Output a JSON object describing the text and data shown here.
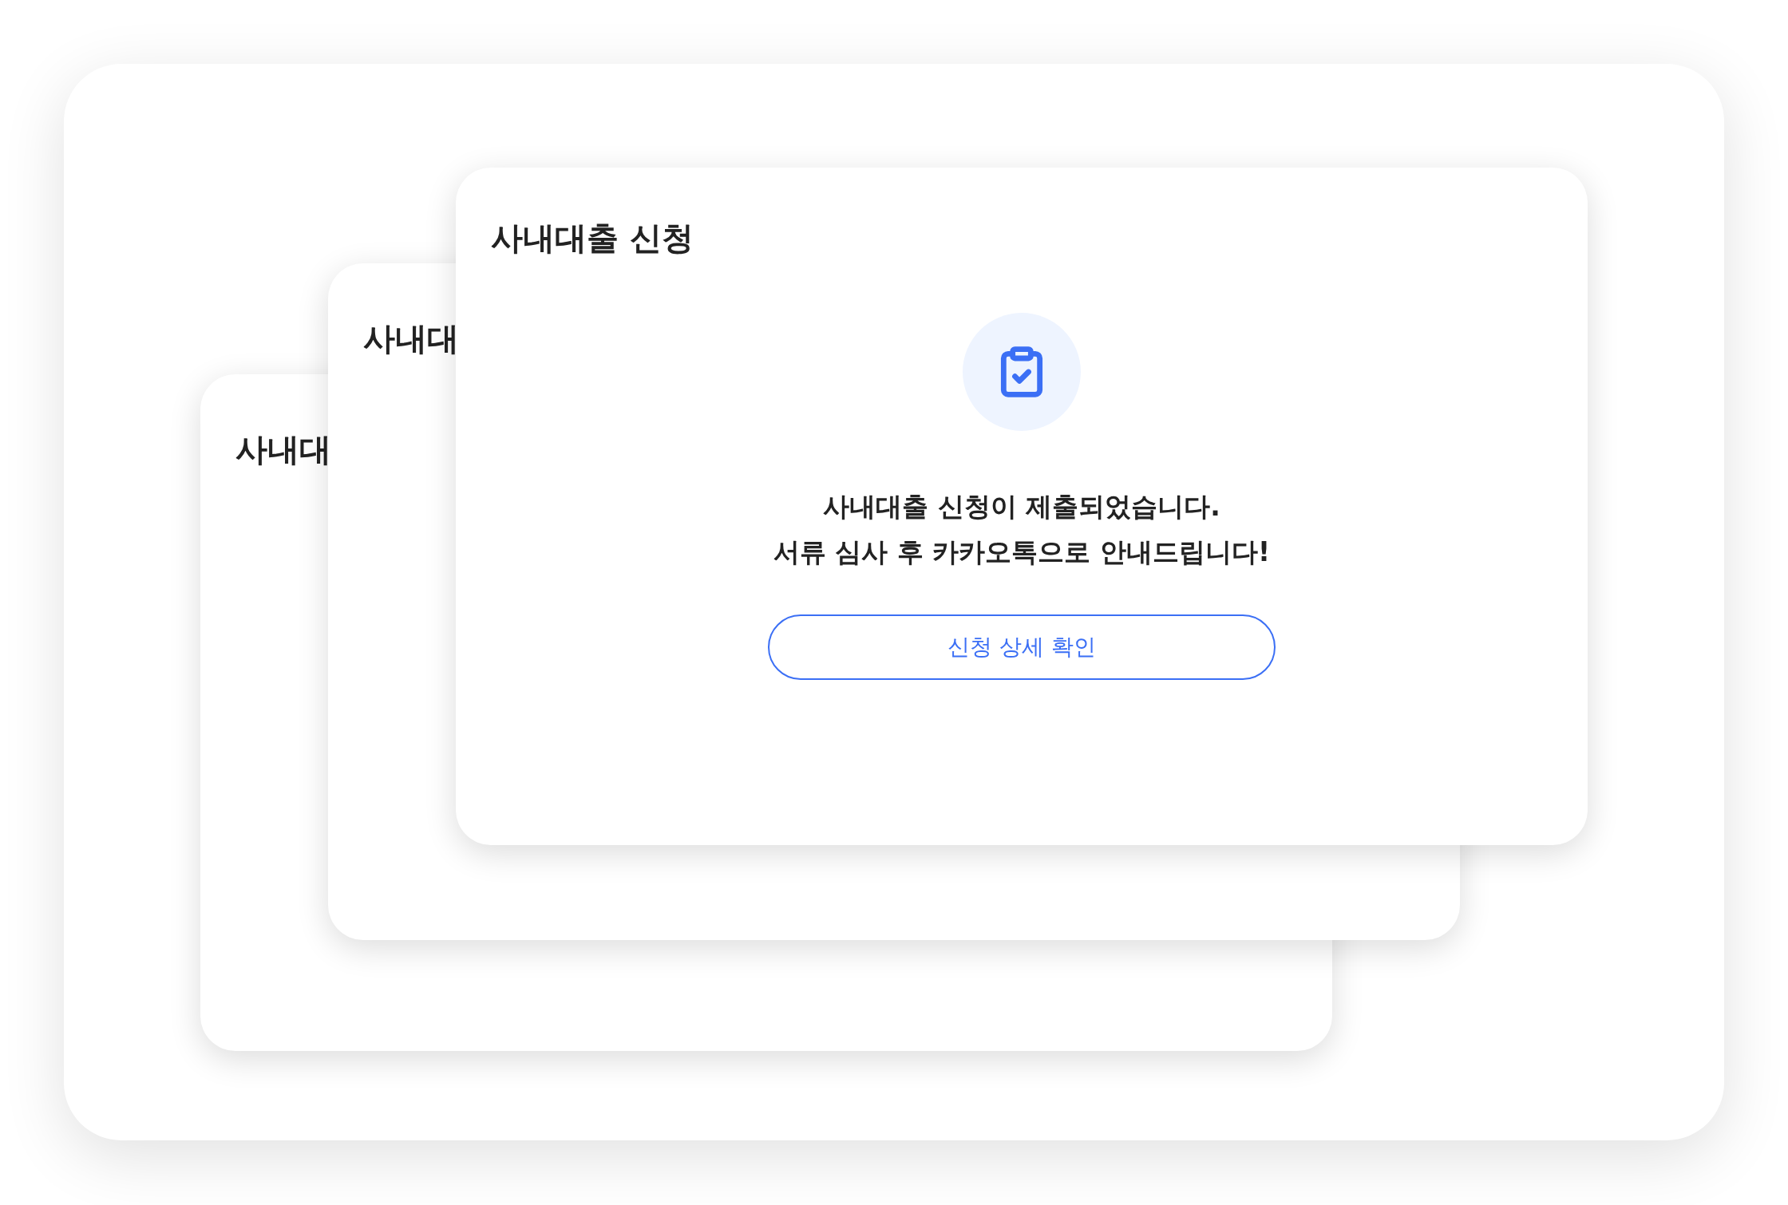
{
  "back_cards": [
    {
      "title": "사내대"
    },
    {
      "title": "사내대"
    }
  ],
  "dialog": {
    "title": "사내대출 신청",
    "message": [
      "사내대출 신청이 제출되었습니다.",
      "서류 심사 후 카카오톡으로 안내드립니다!"
    ],
    "button": "신청 상세 확인"
  }
}
